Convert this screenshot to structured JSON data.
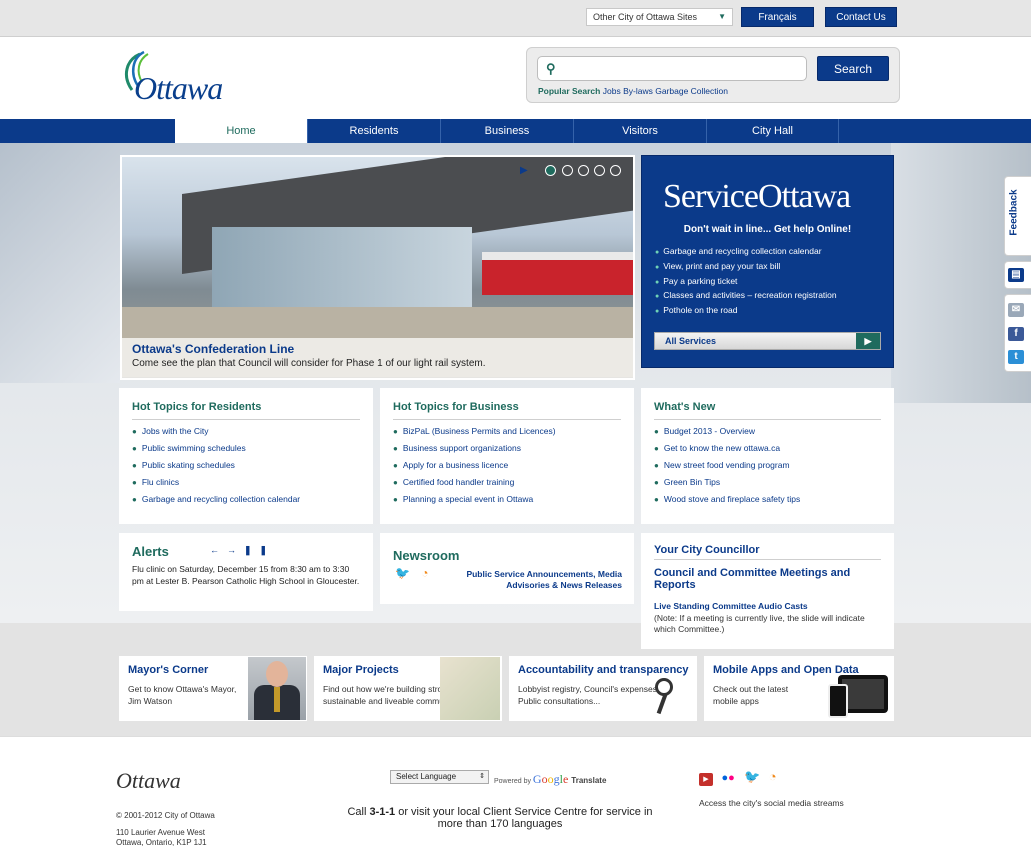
{
  "topbar": {
    "other_sites": "Other City of Ottawa Sites",
    "francais": "Français",
    "contact": "Contact Us"
  },
  "header": {
    "logo": "Ottawa",
    "search_placeholder": "",
    "search_button": "Search",
    "popular_label": "Popular Search",
    "popular_links": [
      "Jobs",
      "By-laws",
      "Garbage Collection"
    ]
  },
  "nav": [
    "Home",
    "Residents",
    "Business",
    "Visitors",
    "City Hall"
  ],
  "slider": {
    "title": "Ottawa's Confederation Line",
    "text": "Come see the plan that Council will consider for Phase 1 of our light rail system.",
    "dots": 5,
    "active_dot": 1
  },
  "service_ottawa": {
    "logo": "ServiceOttawa",
    "tagline": "Don't wait in line... Get help Online!",
    "items": [
      "Garbage and recycling collection calendar",
      "View, print and pay your tax bill",
      "Pay a parking ticket",
      "Classes and activities – recreation registration",
      "Pothole on the road"
    ],
    "all_services": "All Services"
  },
  "hot_residents": {
    "title": "Hot Topics for Residents",
    "items": [
      "Jobs with the City",
      "Public swimming schedules",
      "Public skating schedules",
      "Flu clinics",
      "Garbage and recycling collection calendar"
    ]
  },
  "hot_business": {
    "title": "Hot Topics for Business",
    "items": [
      "BizPaL (Business Permits and Licences)",
      "Business support organizations",
      "Apply for a business licence",
      "Certified food handler training",
      "Planning a special event in Ottawa"
    ]
  },
  "whats_new": {
    "title": "What's New",
    "items": [
      "Budget 2013 - Overview",
      "Get to know the new ottawa.ca",
      "New street food vending program",
      "Green Bin Tips",
      "Wood stove and fireplace safety tips"
    ]
  },
  "alerts": {
    "title": "Alerts",
    "text": "Flu clinic on Saturday, December 15 from 8:30 am to 3:30 pm at Lester B. Pearson Catholic High School in Gloucester."
  },
  "newsroom": {
    "title": "Newsroom",
    "link": "Public Service Announcements, Media Advisories & News Releases"
  },
  "councillor": {
    "title": "Your City Councillor",
    "link1": "Council and Committee Meetings and Reports",
    "link2": "Live Standing Committee Audio Casts",
    "note": "(Note: If a meeting is currently live, the slide will indicate which Committee.)"
  },
  "promos": [
    {
      "title": "Mayor's Corner",
      "text": "Get to know Ottawa's Mayor, Jim Watson"
    },
    {
      "title": "Major Projects",
      "text": "Find out how we're building strong, sustainable and liveable communities"
    },
    {
      "title": "Accountability and transparency",
      "text": "Lobbyist registry, Council's expenses, Public consultations..."
    },
    {
      "title": "Mobile Apps and Open Data",
      "text": "Check out the latest mobile apps"
    }
  ],
  "side": {
    "feedback": "Feedback"
  },
  "footer": {
    "logo": "Ottawa",
    "copyright": "© 2001-2012 City of Ottawa",
    "addr1": "110 Laurier Avenue West",
    "addr2": "Ottawa, Ontario, K1P 1J1",
    "language": "Select Language",
    "powered": "Powered by",
    "google": "Google",
    "translate": "Translate",
    "call_pre": "Call ",
    "call_num": "3-1-1",
    "call_post": " or visit your local Client Service Centre for service in more than 170 languages",
    "social_text": "Access the city's social media streams"
  },
  "colors": {
    "brand_blue": "#0b3a8a",
    "brand_green": "#1f6b5e"
  }
}
